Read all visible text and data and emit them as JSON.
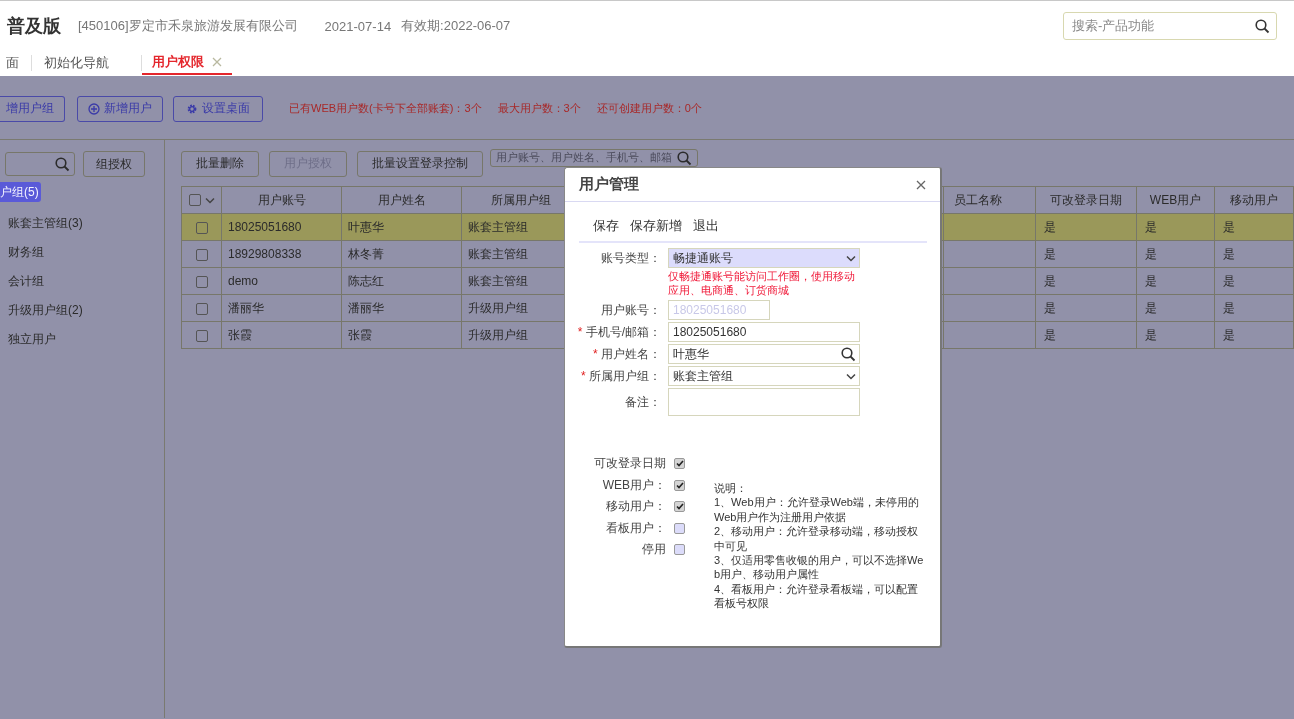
{
  "header": {
    "edition": "普及版",
    "company": "[450106]罗定市禾泉旅游发展有限公司",
    "date": "2021-07-14",
    "validity": "有效期:2022-06-07",
    "search": {
      "placeholder": "搜索-产品功能"
    }
  },
  "tabs": [
    {
      "label": "面",
      "selected": false,
      "closable": false
    },
    {
      "label": "初始化导航",
      "selected": false,
      "closable": false
    },
    {
      "label": "用户权限",
      "selected": true,
      "closable": true
    }
  ],
  "toolbar": {
    "buttons": [
      {
        "label": "增用户组",
        "kind": "plain"
      },
      {
        "label": "新增用户",
        "kind": "add"
      },
      {
        "label": "设置桌面",
        "kind": "settings"
      }
    ],
    "stats": [
      "已有WEB用户数(卡号下全部账套)：3个",
      "最大用户数：3个",
      "还可创建用户数：0个"
    ]
  },
  "sidebar": {
    "button": "组授权",
    "tree": [
      {
        "label": "户组(5)",
        "selected": true,
        "children": [
          {
            "label": "账套主管组(3)",
            "selected": false
          },
          {
            "label": "财务组",
            "selected": false
          },
          {
            "label": "会计组",
            "selected": false
          },
          {
            "label": "升级用户组(2)",
            "selected": false
          },
          {
            "label": "独立用户",
            "selected": false
          }
        ]
      }
    ]
  },
  "table_toolbar": {
    "buttons": [
      {
        "label": "批量删除",
        "disabled": false
      },
      {
        "label": "用户授权",
        "disabled": true
      },
      {
        "label": "批量设置登录控制",
        "disabled": false
      }
    ],
    "search": {
      "placeholder": "用户账号、用户姓名、手机号、邮箱"
    }
  },
  "table": {
    "columns": [
      "用户账号",
      "用户姓名",
      "所属用户组",
      "员工名称",
      "可改登录日期",
      "WEB用户",
      "移动用户"
    ],
    "all_checked": false,
    "rows": [
      {
        "selected": true,
        "checked": false,
        "cells": [
          "18025051680",
          "叶惠华",
          "账套主管组",
          "",
          "是",
          "是",
          "是"
        ]
      },
      {
        "selected": false,
        "checked": false,
        "cells": [
          "18929808338",
          "林冬菁",
          "账套主管组",
          "",
          "是",
          "是",
          "是"
        ]
      },
      {
        "selected": false,
        "checked": false,
        "cells": [
          "demo",
          "陈志红",
          "账套主管组",
          "",
          "是",
          "是",
          "是"
        ]
      },
      {
        "selected": false,
        "checked": false,
        "cells": [
          "潘丽华",
          "潘丽华",
          "升级用户组",
          "",
          "是",
          "是",
          "是"
        ]
      },
      {
        "selected": false,
        "checked": false,
        "cells": [
          "张霞",
          "张霞",
          "升级用户组",
          "",
          "是",
          "是",
          "是"
        ]
      }
    ]
  },
  "dialog": {
    "title": "用户管理",
    "actions": [
      "保存",
      "保存新增",
      "退出"
    ],
    "fields": [
      {
        "kind": "select",
        "label": "账号类型：",
        "value": "畅捷通账号",
        "focused": true,
        "hint": "仅畅捷通账号能访问工作圈，使用移动应用、电商通、订货商城"
      },
      {
        "kind": "text",
        "label": "用户账号：",
        "value": "18025051680",
        "disabled": true,
        "short": true
      },
      {
        "kind": "text",
        "label": "手机号/邮箱：",
        "value": "18025051680",
        "required_mark": "*"
      },
      {
        "kind": "lookup",
        "label": "用户姓名：",
        "value": "叶惠华",
        "required_mark": "*"
      },
      {
        "kind": "select",
        "label": "所属用户组：",
        "value": "账套主管组",
        "required_mark": "*"
      },
      {
        "kind": "textarea",
        "label": "备注："
      }
    ],
    "options": [
      {
        "label": "可改登录日期",
        "checked": true
      },
      {
        "label": "WEB用户：",
        "checked": true
      },
      {
        "label": "移动用户：",
        "checked": true
      },
      {
        "label": "看板用户：",
        "checked": false
      },
      {
        "label": "停用",
        "checked": false
      }
    ],
    "notes": {
      "title": "说明：",
      "items": [
        "1、Web用户：允许登录Web端，未停用的Web用户作为注册用户依据",
        "2、移动用户：允许登录移动端，移动授权中可见",
        "3、仅适用零售收银的用户，可以不选择Web用户、移动用户属性",
        "4、看板用户：允许登录看板端，可以配置看板号权限"
      ]
    }
  }
}
